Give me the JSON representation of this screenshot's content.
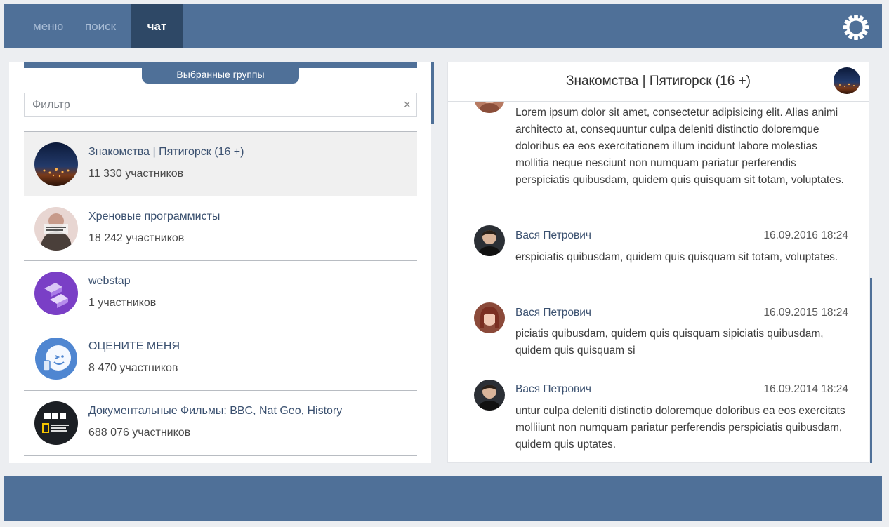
{
  "nav": {
    "menu_label": "меню",
    "search_label": "поиск",
    "chat_label": "чат",
    "settings_icon": "gear-icon"
  },
  "groups_panel": {
    "tab_label": "Выбранные группы",
    "filter_placeholder": "Фильтр",
    "clear_icon": "×",
    "items": [
      {
        "name": "Знакомства | Пятигорск (16 +)",
        "members": "11 330 участников",
        "active": true
      },
      {
        "name": "Хреновые программисты",
        "members": "18 242 участников"
      },
      {
        "name": "webstap",
        "members": "1 участников"
      },
      {
        "name": "ОЦЕНИТЕ МЕНЯ",
        "members": "8 470 участников"
      },
      {
        "name": "Документальные Фильмы: BBC, Nat Geo, History",
        "members": "688 076 участников"
      }
    ]
  },
  "chat": {
    "title": "Знакомства | Пятигорск (16 +)",
    "messages": [
      {
        "author": "",
        "time": "",
        "text": "Lorem ipsum dolor sit amet, consectetur adipisicing elit. Alias animi architecto at, consequuntur culpa deleniti distinctio doloremque doloribus ea eos exercitationem illum incidunt labore molestias mollitia neque nesciunt non numquam pariatur perferendis perspiciatis quibusdam, quidem quis quisquam sit totam, voluptates."
      },
      {
        "author": "Вася Петрович",
        "time": "16.09.2016 18:24",
        "text": "erspiciatis quibusdam, quidem quis quisquam sit totam, voluptates."
      },
      {
        "author": "Вася Петрович",
        "time": "16.09.2015 18:24",
        "text": "piciatis quibusdam, quidem quis quisquam sipiciatis quibusdam, quidem quis quisquam si"
      },
      {
        "author": "Вася Петрович",
        "time": "16.09.2014 18:24",
        "text": "untur culpa deleniti distinctio doloremque doloribus ea eos exercitats molliiunt non numquam pariatur perferendis perspiciatis quibusdam, quidem quis uptates."
      }
    ]
  }
}
